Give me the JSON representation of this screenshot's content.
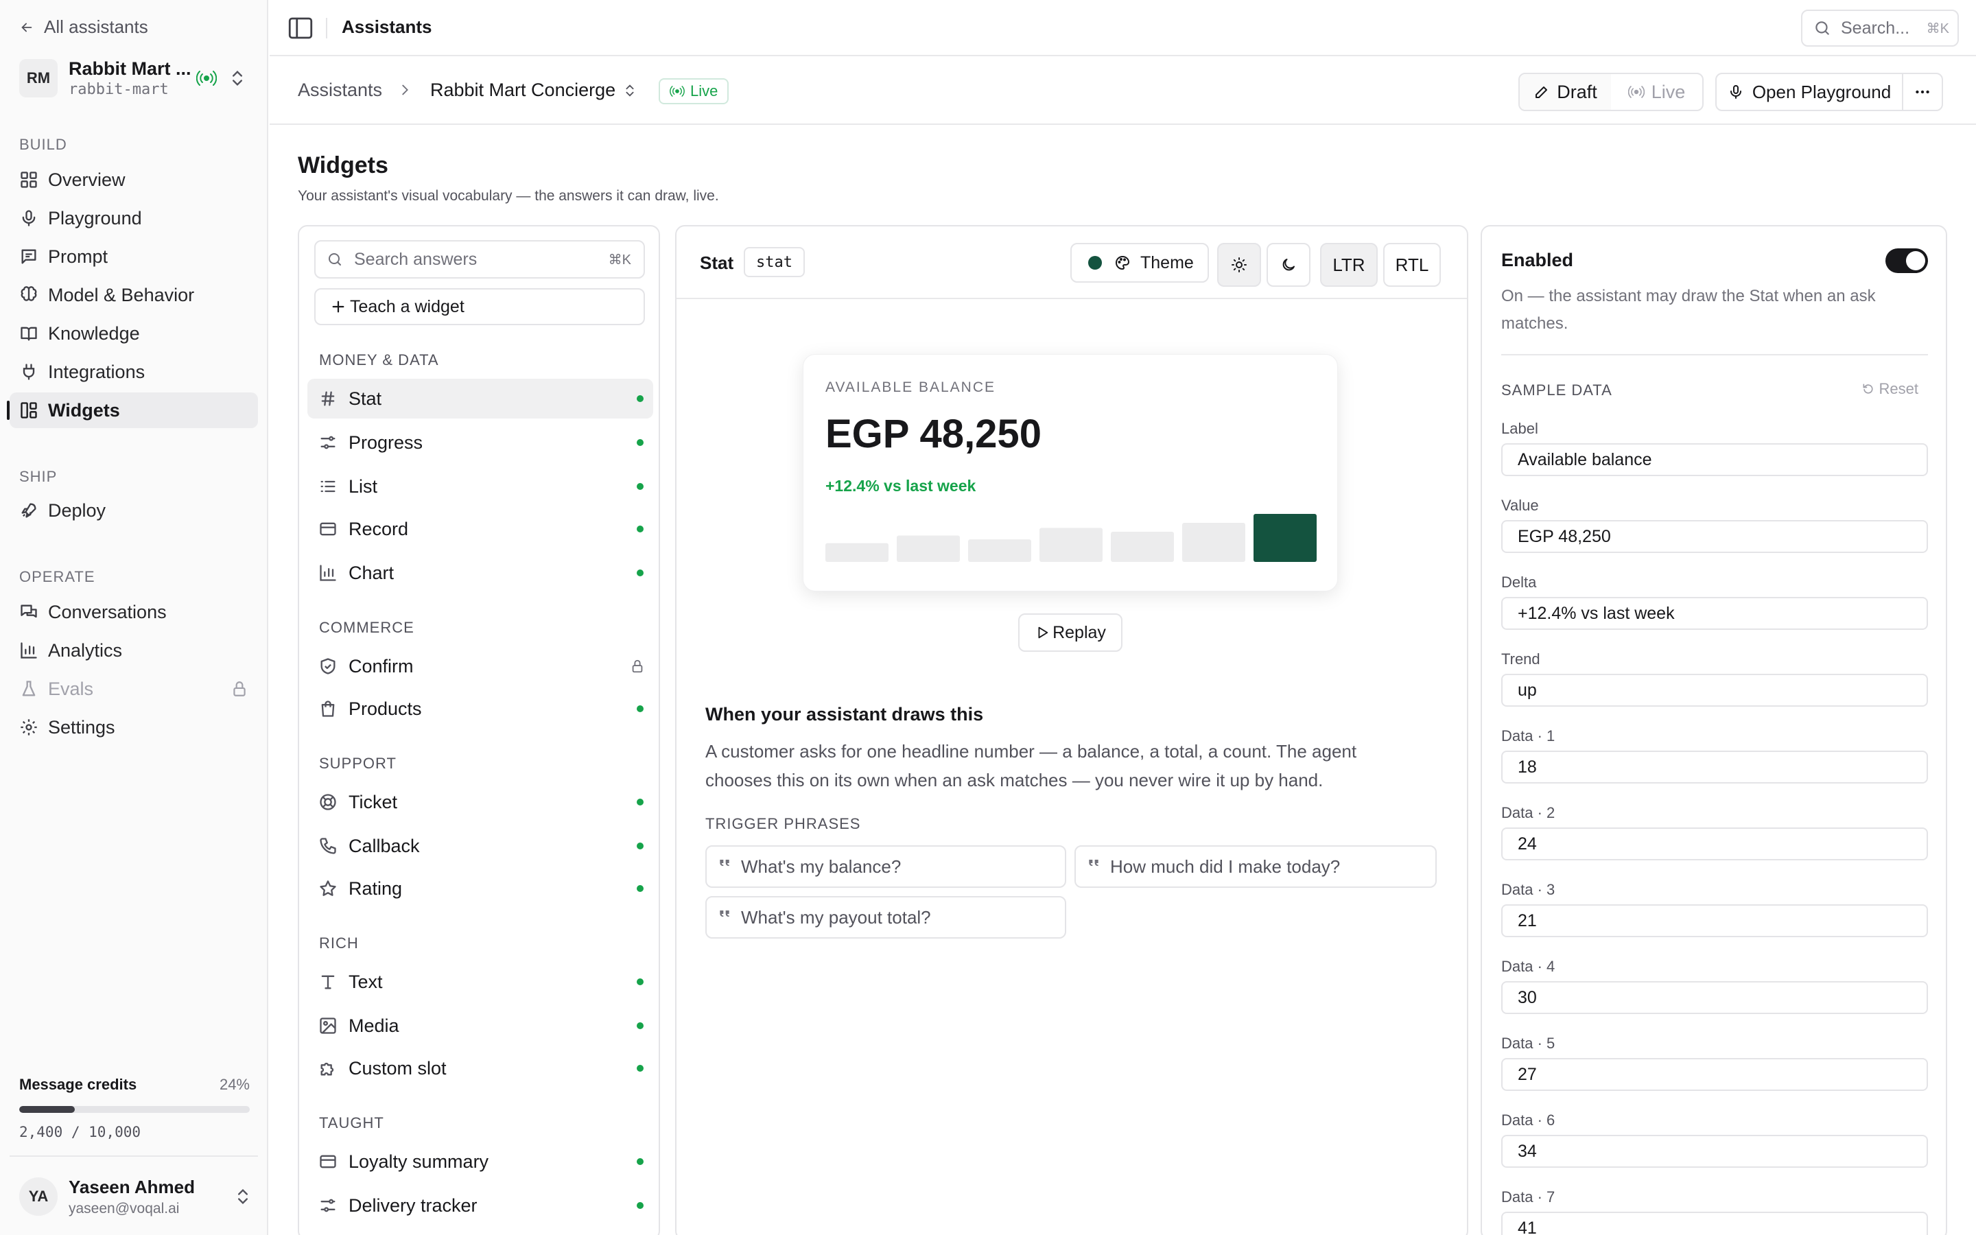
{
  "sidebar": {
    "back_label": "All assistants",
    "workspace": {
      "initials": "RM",
      "name": "Rabbit Mart ...",
      "slug": "rabbit-mart"
    },
    "sections": {
      "build": "BUILD",
      "ship": "SHIP",
      "operate": "OPERATE"
    },
    "build_items": [
      {
        "label": "Overview",
        "icon": "grid-icon"
      },
      {
        "label": "Playground",
        "icon": "mic-icon"
      },
      {
        "label": "Prompt",
        "icon": "message-icon"
      },
      {
        "label": "Model & Behavior",
        "icon": "brain-icon"
      },
      {
        "label": "Knowledge",
        "icon": "book-icon"
      },
      {
        "label": "Integrations",
        "icon": "plug-icon"
      },
      {
        "label": "Widgets",
        "icon": "layout-icon",
        "active": true
      }
    ],
    "ship_items": [
      {
        "label": "Deploy",
        "icon": "rocket-icon"
      }
    ],
    "operate_items": [
      {
        "label": "Conversations",
        "icon": "chats-icon"
      },
      {
        "label": "Analytics",
        "icon": "bar-chart-icon"
      },
      {
        "label": "Evals",
        "icon": "flask-icon",
        "locked": true
      },
      {
        "label": "Settings",
        "icon": "gear-icon"
      }
    ],
    "credits": {
      "label": "Message credits",
      "percent_label": "24%",
      "percent": 24,
      "used_total": "2,400 / 10,000"
    },
    "user": {
      "initials": "YA",
      "name": "Yaseen Ahmed",
      "email": "yaseen@voqal.ai"
    }
  },
  "topbar": {
    "title": "Assistants",
    "search_placeholder": "Search...",
    "search_shortcut": "⌘K"
  },
  "header": {
    "breadcrumb_root": "Assistants",
    "assistant_name": "Rabbit Mart Concierge",
    "status_badge": "Live",
    "mode_draft": "Draft",
    "mode_live": "Live",
    "open_playground": "Open Playground"
  },
  "page": {
    "title": "Widgets",
    "subtitle": "Your assistant's visual vocabulary — the answers it can draw, live."
  },
  "widget_list": {
    "search_placeholder": "Search answers",
    "search_shortcut": "⌘K",
    "teach_label": "Teach a widget",
    "groups": {
      "money": "MONEY & DATA",
      "commerce": "COMMERCE",
      "support": "SUPPORT",
      "rich": "RICH",
      "taught": "TAUGHT"
    },
    "items": {
      "stat": "Stat",
      "progress": "Progress",
      "list": "List",
      "record": "Record",
      "chart": "Chart",
      "confirm": "Confirm",
      "products": "Products",
      "ticket": "Ticket",
      "callback": "Callback",
      "rating": "Rating",
      "text": "Text",
      "media": "Media",
      "custom_slot": "Custom slot",
      "loyalty": "Loyalty summary",
      "delivery": "Delivery tracker"
    }
  },
  "preview": {
    "widget_name": "Stat",
    "widget_code": "stat",
    "theme_label": "Theme",
    "theme_color": "#14533f",
    "accent_green": "#16a34a",
    "dir_ltr": "LTR",
    "dir_rtl": "RTL",
    "card": {
      "label": "AVAILABLE BALANCE",
      "value": "EGP 48,250",
      "delta": "+12.4% vs last week",
      "trend_bars": [
        18,
        24,
        21,
        30,
        27,
        34,
        41
      ]
    },
    "replay_label": "Replay",
    "when_title": "When your assistant draws this",
    "when_desc": "A customer asks for one headline number — a balance, a total, a count. The agent chooses this on its own when an ask matches — you never wire it up by hand.",
    "trigger_label": "TRIGGER PHRASES",
    "phrases": [
      "What's my balance?",
      "How much did I make today?",
      "What's my payout total?"
    ]
  },
  "config": {
    "enabled_title": "Enabled",
    "enabled_desc": "On — the assistant may draw the Stat when an ask matches.",
    "sample_title": "SAMPLE DATA",
    "reset_label": "Reset",
    "fields": [
      {
        "label": "Label",
        "value": "Available balance"
      },
      {
        "label": "Value",
        "value": "EGP 48,250"
      },
      {
        "label": "Delta",
        "value": "+12.4% vs last week"
      },
      {
        "label": "Trend",
        "value": "up"
      },
      {
        "label": "Data · 1",
        "value": "18"
      },
      {
        "label": "Data · 2",
        "value": "24"
      },
      {
        "label": "Data · 3",
        "value": "21"
      },
      {
        "label": "Data · 4",
        "value": "30"
      },
      {
        "label": "Data · 5",
        "value": "27"
      },
      {
        "label": "Data · 6",
        "value": "34"
      },
      {
        "label": "Data · 7",
        "value": "41"
      }
    ]
  }
}
